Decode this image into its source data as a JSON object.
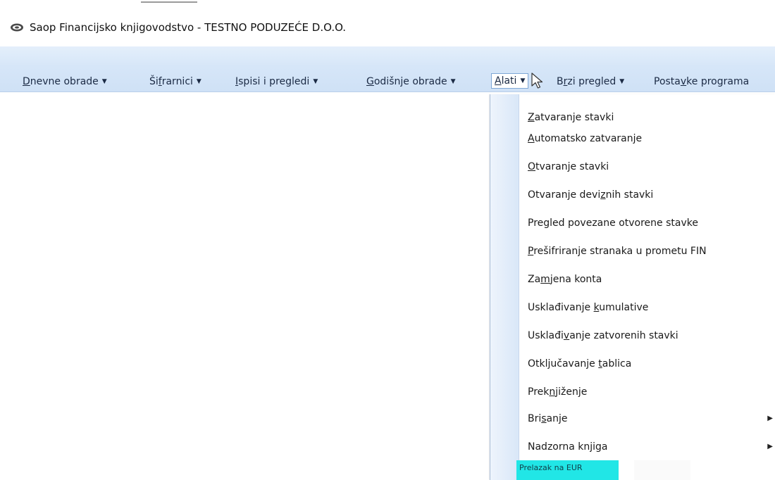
{
  "window": {
    "title": "Saop Financijsko knjigovodstvo - TESTNO PODUZEĆE D.O.O."
  },
  "menubar": {
    "items": [
      {
        "label_before": "",
        "label_underline": "D",
        "label_after": "nevne obrade",
        "has_caret": true
      },
      {
        "label_before": "Ši",
        "label_underline": "f",
        "label_after": "rarnici",
        "has_caret": true
      },
      {
        "label_before": "",
        "label_underline": "I",
        "label_after": "spisi i pregledi",
        "has_caret": true
      },
      {
        "label_before": "",
        "label_underline": "G",
        "label_after": "odišnje obrade",
        "has_caret": true
      },
      {
        "label_before": "",
        "label_underline": "A",
        "label_after": "lati",
        "has_caret": true
      },
      {
        "label_before": "B",
        "label_underline": "r",
        "label_after": "zi pregled",
        "has_caret": true
      },
      {
        "label_before": "Posta",
        "label_underline": "v",
        "label_after": "ke programa",
        "has_caret": false
      }
    ]
  },
  "alati_menu": {
    "items": [
      {
        "before": "",
        "ul": "Z",
        "after": "atvaranje stavki",
        "submenu": false
      },
      {
        "before": "",
        "ul": "A",
        "after": "utomatsko zatvaranje",
        "submenu": false
      },
      {
        "before": "",
        "ul": "O",
        "after": "tvaranje stavki",
        "submenu": false
      },
      {
        "before": "Otvaranje devi",
        "ul": "z",
        "after": "nih stavki",
        "submenu": false
      },
      {
        "before": "Pregled povezane otvorene stavke",
        "ul": "",
        "after": "",
        "submenu": false
      },
      {
        "before": "",
        "ul": "P",
        "after": "rešifriranje stranaka u prometu FIN",
        "submenu": false
      },
      {
        "before": "Za",
        "ul": "m",
        "after": "jena konta",
        "submenu": false
      },
      {
        "before": "Usklađivanje ",
        "ul": "k",
        "after": "umulative",
        "submenu": false
      },
      {
        "before": "Usklađi",
        "ul": "v",
        "after": "anje zatvorenih stavki",
        "submenu": false
      },
      {
        "before": "Otključavanje ",
        "ul": "t",
        "after": "ablica",
        "submenu": false
      },
      {
        "before": "Prek",
        "ul": "n",
        "after": "jiženje",
        "submenu": false
      },
      {
        "before": "Bri",
        "ul": "s",
        "after": "anje",
        "submenu": true
      },
      {
        "before": "Nadzorna knjiga",
        "ul": "",
        "after": "",
        "submenu": true
      }
    ],
    "highlighted_item": "Prelazak na EUR"
  },
  "colors": {
    "menubar": "#d6e6f8",
    "highlight": "#21e6e6"
  }
}
